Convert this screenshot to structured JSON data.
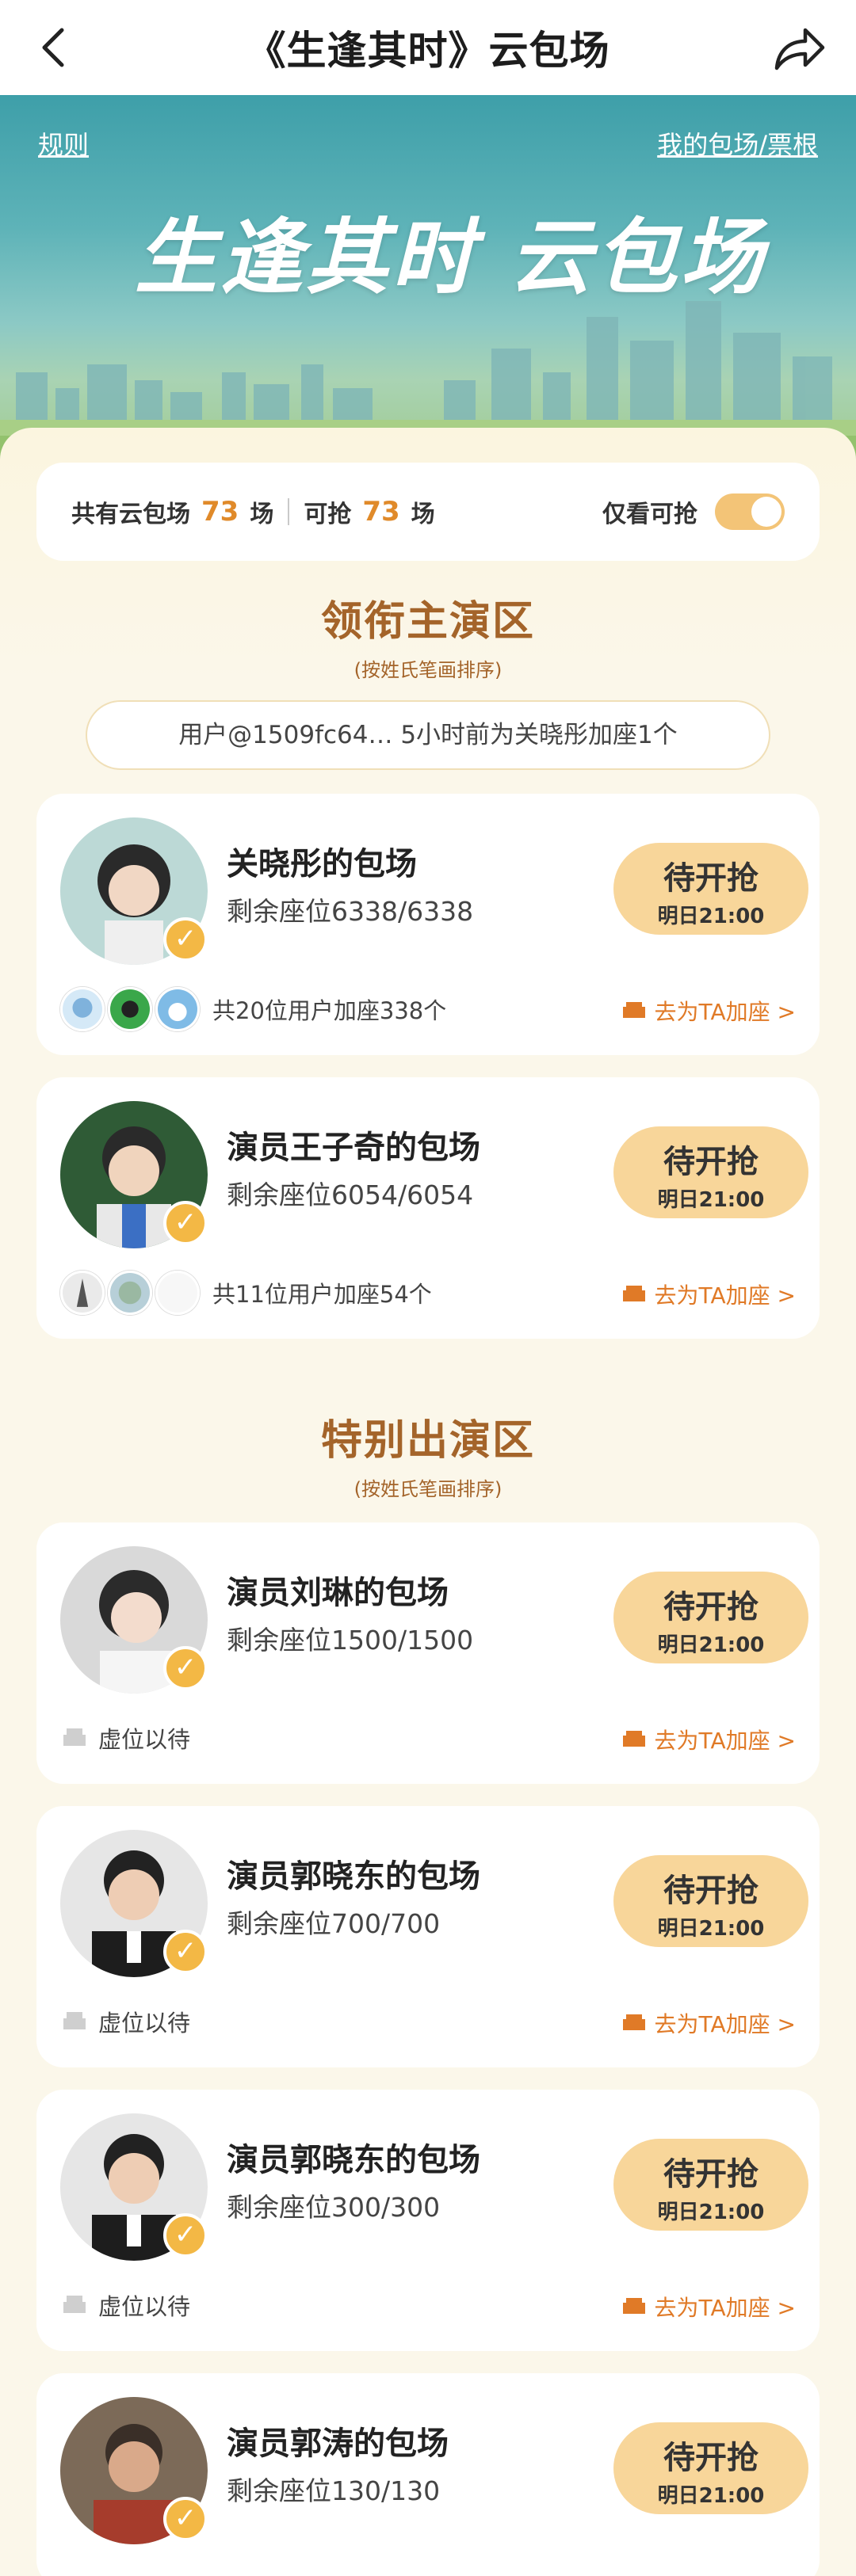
{
  "nav": {
    "title": "《生逢其时》云包场"
  },
  "banner": {
    "rules": "规则",
    "mine": "我的包场/票根",
    "title": "生逢其时 云包场"
  },
  "summary": {
    "total_label": "共有云包场",
    "total": "73",
    "unit1": "场",
    "grab_label": "可抢",
    "grab": "73",
    "unit2": "场",
    "toggle_label": "仅看可抢"
  },
  "lead": {
    "title": "领衔主演区",
    "sub": "(按姓氏笔画排序)"
  },
  "notice": "用户@1509fc64… 5小时前为关晓彤加座1个",
  "special": {
    "title": "特别出演区",
    "sub": "(按姓氏笔画排序)"
  },
  "cards": [
    {
      "name": "关晓彤的包场",
      "seats": "剩余座位6338/6338",
      "btn": "待开抢",
      "time": "明日21:00",
      "foot": "共20位用户加座338个",
      "link": "去为TA加座 >"
    },
    {
      "name": "演员王子奇的包场",
      "seats": "剩余座位6054/6054",
      "btn": "待开抢",
      "time": "明日21:00",
      "foot": "共11位用户加座54个",
      "link": "去为TA加座 >"
    },
    {
      "name": "演员刘琳的包场",
      "seats": "剩余座位1500/1500",
      "btn": "待开抢",
      "time": "明日21:00",
      "foot": "虚位以待",
      "link": "去为TA加座 >"
    },
    {
      "name": "演员郭晓东的包场",
      "seats": "剩余座位700/700",
      "btn": "待开抢",
      "time": "明日21:00",
      "foot": "虚位以待",
      "link": "去为TA加座 >"
    },
    {
      "name": "演员郭晓东的包场",
      "seats": "剩余座位300/300",
      "btn": "待开抢",
      "time": "明日21:00",
      "foot": "虚位以待",
      "link": "去为TA加座 >"
    },
    {
      "name": "演员郭涛的包场",
      "seats": "剩余座位130/130",
      "btn": "待开抢",
      "time": "明日21:00"
    }
  ],
  "colors": {
    "accent": "#e08a2a",
    "brown": "#a4642a",
    "button": "#f8d69a",
    "toggle": "#f3c477"
  }
}
